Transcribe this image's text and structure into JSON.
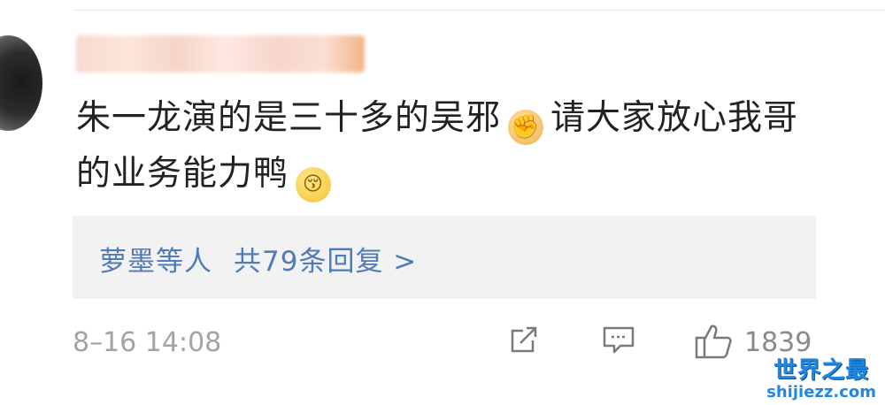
{
  "comment": {
    "author_name": "",
    "text_part1": "朱一龙演的是三十多的吴邪",
    "emoji1": "fist-emoji",
    "text_part2": "请大家放心我哥的业务能力鸭",
    "emoji2": "kissing-emoji"
  },
  "replies": {
    "users": "萝墨等人",
    "count_label": "共79条回复 >"
  },
  "footer": {
    "timestamp": "8–16 14:08",
    "like_count": "1839"
  },
  "watermark": {
    "title": "世界之最",
    "url": "shijiezz.com"
  },
  "colors": {
    "link_blue": "#4f7cb8",
    "meta_gray": "#a3a3a3",
    "reply_bg": "#f2f2f2"
  }
}
